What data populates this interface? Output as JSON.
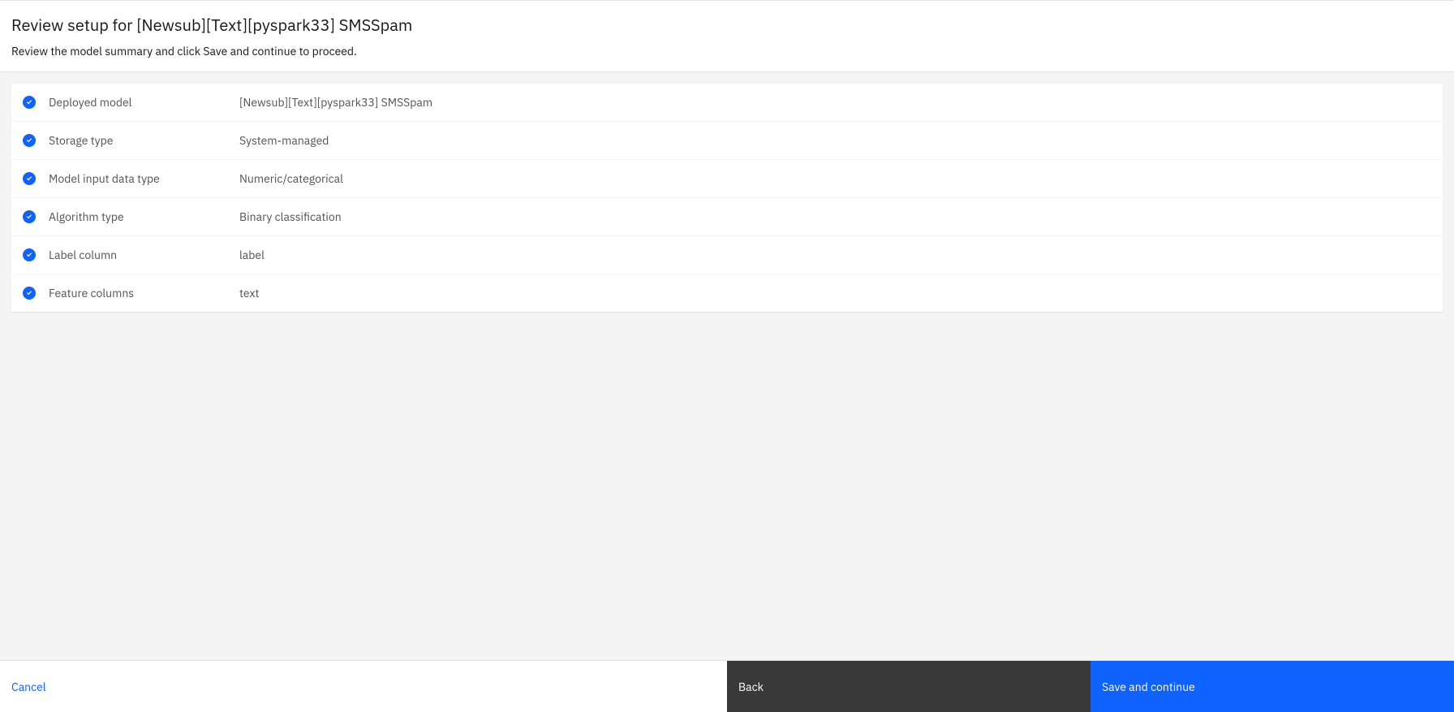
{
  "header": {
    "title": "Review setup for [Newsub][Text][pyspark33] SMSSpam",
    "subtitle": "Review the model summary and click Save and continue to proceed."
  },
  "summary": [
    {
      "label": "Deployed model",
      "value": "[Newsub][Text][pyspark33] SMSSpam"
    },
    {
      "label": "Storage type",
      "value": "System-managed"
    },
    {
      "label": "Model input data type",
      "value": "Numeric/categorical"
    },
    {
      "label": "Algorithm type",
      "value": "Binary classification"
    },
    {
      "label": "Label column",
      "value": "label"
    },
    {
      "label": "Feature columns",
      "value": "text"
    }
  ],
  "footer": {
    "cancel": "Cancel",
    "back": "Back",
    "save": "Save and continue"
  }
}
